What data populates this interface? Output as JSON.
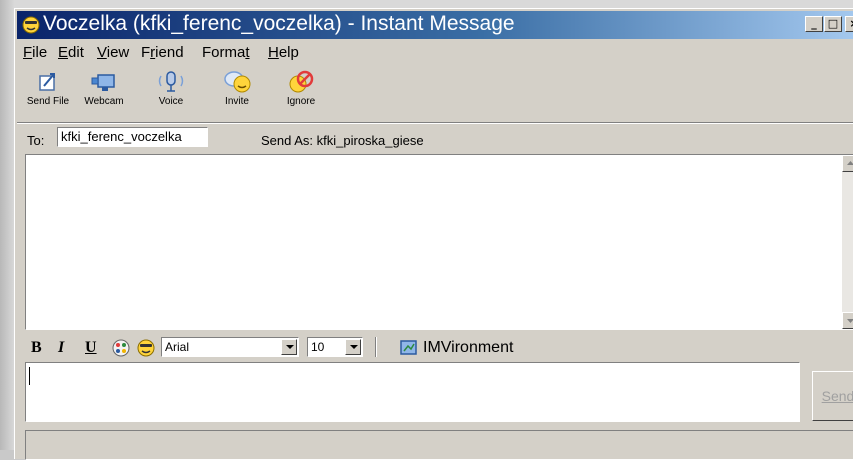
{
  "window": {
    "title": "Voczelka (kfki_ferenc_voczelka) - Instant Message"
  },
  "title_buttons": {
    "minimize": "_",
    "maximize": "□",
    "close": "×"
  },
  "menu": [
    {
      "label": "File",
      "key": "F",
      "rest": "ile"
    },
    {
      "label": "Edit",
      "key": "E",
      "rest": "dit"
    },
    {
      "label": "View",
      "key": "V",
      "rest": "iew"
    },
    {
      "label": "Friend",
      "pre": "F",
      "key": "r",
      "rest": "iend"
    },
    {
      "label": "Format",
      "pre": "Forma",
      "key": "t",
      "rest": ""
    },
    {
      "label": "Help",
      "key": "H",
      "rest": "elp"
    }
  ],
  "toolbar": {
    "send_file": {
      "label": "Send File",
      "icon": "send-file-icon"
    },
    "webcam": {
      "label": "Webcam",
      "icon": "webcam-icon"
    },
    "voice": {
      "label": "Voice",
      "icon": "microphone-icon"
    },
    "invite": {
      "label": "Invite",
      "icon": "invite-icon"
    },
    "ignore": {
      "label": "Ignore",
      "icon": "ignore-icon"
    }
  },
  "address": {
    "to_label": "To:",
    "to_value": "kfki_ferenc_voczelka",
    "send_as": "Send As:  kfki_piroska_giese"
  },
  "format_bar": {
    "bold": "B",
    "italic": "I",
    "underline": "U",
    "font": "Arial",
    "size": "10",
    "imvironment": "IMVironment"
  },
  "compose": {
    "value": ""
  },
  "send_button": {
    "label": "Send",
    "enabled": false
  },
  "colors": {
    "title_start": "#0a246a",
    "title_end": "#a6caf0",
    "face": "#d4d0c8"
  }
}
